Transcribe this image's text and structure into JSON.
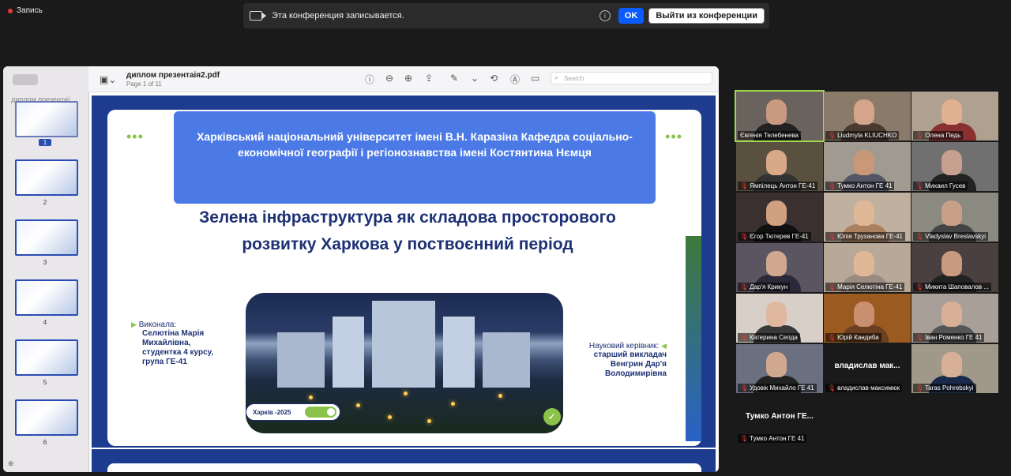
{
  "recording_label": "Запись",
  "banner": {
    "message": "Эта конференция записывается.",
    "info_glyph": "i",
    "ok_label": "OK",
    "leave_label": "Выйти из конференции"
  },
  "pdf": {
    "sidebar_title": "диплом презентаї...",
    "filename": "диплом презентаія2.pdf",
    "page_info": "Page 1 of 11",
    "search_placeholder": "Search",
    "thumbnails": [
      "1",
      "2",
      "3",
      "4",
      "5",
      "6"
    ]
  },
  "slide": {
    "header": "Харківський національний університет імені В.Н. Каразіна Кафедра соціально-економічної географії і регіонознавства імені Костянтина Нємця",
    "title": "Зелена інфраструктура як складова просторового розвитку Харкова у поствоєнний період",
    "author_label": "Виконала:",
    "author_value": "Селютіна Марія Михайлівна, студентка 4 курсу, група ГЕ-41",
    "advisor_label": "Науковий керівник:",
    "advisor_value": "старший викладач Венгрин Дар'я Володимирівна",
    "toggle_label": "Харків -2025",
    "check_glyph": "✓"
  },
  "participants": [
    {
      "name": "Євгенія Телебенева",
      "muted": false,
      "face": "#c89a80",
      "body": "#222",
      "bg": "#6a625c"
    },
    {
      "name": "Liudmyla KLIUCHKO",
      "muted": true,
      "face": "#d4a58a",
      "body": "#4a3a30",
      "bg": "#8a7a6a"
    },
    {
      "name": "Олена Педь",
      "muted": true,
      "face": "#e0b090",
      "body": "#8a3030",
      "bg": "#b0a090"
    },
    {
      "name": "Ямпілець Антон ГЕ-41",
      "muted": true,
      "face": "#d8a888",
      "body": "#333",
      "bg": "#5a5040"
    },
    {
      "name": "Тумко Антон ГЕ 41",
      "muted": true,
      "face": "#c89878",
      "body": "#556",
      "bg": "#a09a90"
    },
    {
      "name": "Михаил Гусев",
      "muted": true,
      "face": "#c8a090",
      "body": "#222",
      "bg": "#707070"
    },
    {
      "name": "Єгор Тютерев ГЕ-41",
      "muted": true,
      "face": "#d0a080",
      "body": "#111",
      "bg": "#3a3030"
    },
    {
      "name": "Юлія Труханова ГЕ-41",
      "muted": true,
      "face": "#e0b898",
      "body": "#aa8060",
      "bg": "#c0b0a0"
    },
    {
      "name": "Vladyslav Breslavskyi",
      "muted": true,
      "face": "#c8a088",
      "body": "#444",
      "bg": "#8a8a80"
    },
    {
      "name": "Дар'я Крикун",
      "muted": true,
      "face": "#d0a890",
      "body": "#2a2a3a",
      "bg": "#5a5560"
    },
    {
      "name": "Марія Селютіна ГЕ-41",
      "muted": true,
      "face": "#e0b898",
      "body": "#9a8a80",
      "bg": "#b8a898"
    },
    {
      "name": "Микита Шаповалов ...",
      "muted": true,
      "face": "#c89a80",
      "body": "#222",
      "bg": "#4a4040"
    },
    {
      "name": "Катерина Сепда",
      "muted": true,
      "face": "#e0b8a0",
      "body": "#3a3a3a",
      "bg": "#d8d0c8"
    },
    {
      "name": "Юрій Кандиба",
      "muted": true,
      "face": "#c89070",
      "body": "#6a4020",
      "bg": "#9a5a20"
    },
    {
      "name": "Іван Роменко ГЕ 41",
      "muted": true,
      "face": "#d8b098",
      "body": "#555",
      "bg": "#a8a098"
    },
    {
      "name": "Удовік Михайло ГЕ 41",
      "muted": true,
      "face": "#d0a890",
      "body": "#222",
      "bg": "#6a7080"
    },
    {
      "name": "владислав максимюк",
      "muted": true,
      "blank": true,
      "big": "владислав мак..."
    },
    {
      "name": "Taras Pohrebskyi",
      "muted": true,
      "face": "#d8b098",
      "body": "#1a2a4a",
      "bg": "#a09888"
    },
    {
      "name": "Тумко Антон ГЕ 41",
      "muted": true,
      "blank": true,
      "big": "Тумко Антон ГЕ..."
    }
  ]
}
